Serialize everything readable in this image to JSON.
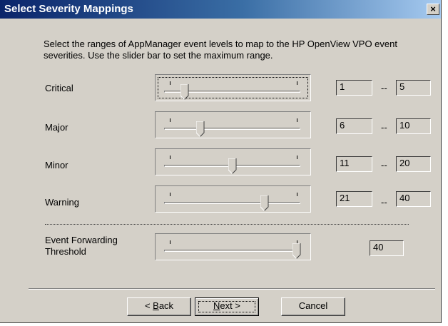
{
  "window": {
    "title": "Select Severity Mappings",
    "close_label": "×"
  },
  "intro": "Select the ranges of AppManager event levels to map to the HP OpenView VPO event severities. Use the slider bar to set the maximum range.",
  "severities": [
    {
      "label": "Critical",
      "min": "1",
      "max": "5",
      "slider_fraction": 0.13
    },
    {
      "label": "Major",
      "min": "6",
      "max": "10",
      "slider_fraction": 0.25
    },
    {
      "label": "Minor",
      "min": "11",
      "max": "20",
      "slider_fraction": 0.5
    },
    {
      "label": "Warning",
      "min": "21",
      "max": "40",
      "slider_fraction": 0.75
    }
  ],
  "range_separator": "--",
  "threshold": {
    "label_line1": "Event Forwarding",
    "label_line2": "Threshold",
    "value": "40",
    "slider_fraction": 1.0
  },
  "buttons": {
    "back_prefix": "< ",
    "back_mnemonic": "B",
    "back_rest": "ack",
    "next_mnemonic": "N",
    "next_rest": "ext >",
    "cancel": "Cancel"
  }
}
